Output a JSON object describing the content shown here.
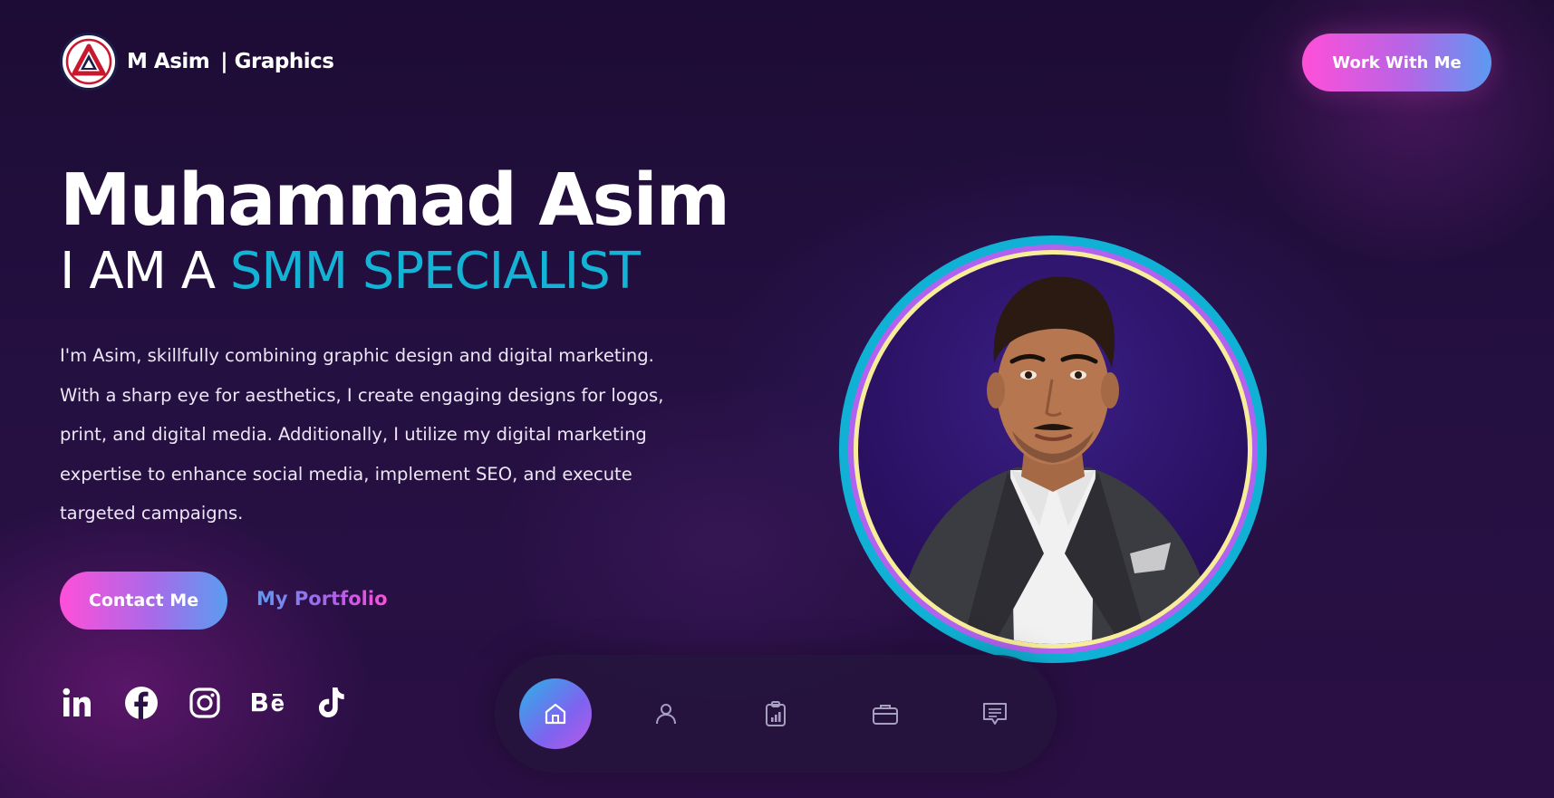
{
  "brand": {
    "name": "M Asim",
    "separator": "| Graphics",
    "logo_icon": "triangle-logo-icon",
    "colors": {
      "accent_cyan": "#14b3d6",
      "gradient_pink": "#ff4fd8",
      "gradient_blue": "#5b9af1",
      "background": "#1d0c35"
    }
  },
  "header": {
    "cta_label": "Work With Me"
  },
  "hero": {
    "name": "Muhammad  Asim",
    "role_prefix": "I AM A",
    "role_highlight": "SMM SPECIALIST",
    "bio": "I'm Asim, skillfully combining graphic design and digital marketing. With a sharp eye for aesthetics, I create engaging designs for logos, print, and digital media. Additionally, I utilize my digital marketing expertise to enhance social media, implement SEO, and execute targeted campaigns.",
    "primary_button": "Contact Me",
    "secondary_link": "My Portfolio",
    "portrait_icon": "profile-photo"
  },
  "socials": [
    {
      "icon": "linkedin-icon",
      "label": "in"
    },
    {
      "icon": "facebook-icon",
      "label": "f"
    },
    {
      "icon": "instagram-icon"
    },
    {
      "icon": "behance-icon",
      "label": "Bē"
    },
    {
      "icon": "tiktok-icon"
    }
  ],
  "dock": {
    "items": [
      {
        "icon": "home-icon",
        "active": true
      },
      {
        "icon": "user-icon",
        "active": false
      },
      {
        "icon": "clipboard-chart-icon",
        "active": false
      },
      {
        "icon": "briefcase-icon",
        "active": false
      },
      {
        "icon": "chat-icon",
        "active": false
      }
    ]
  }
}
